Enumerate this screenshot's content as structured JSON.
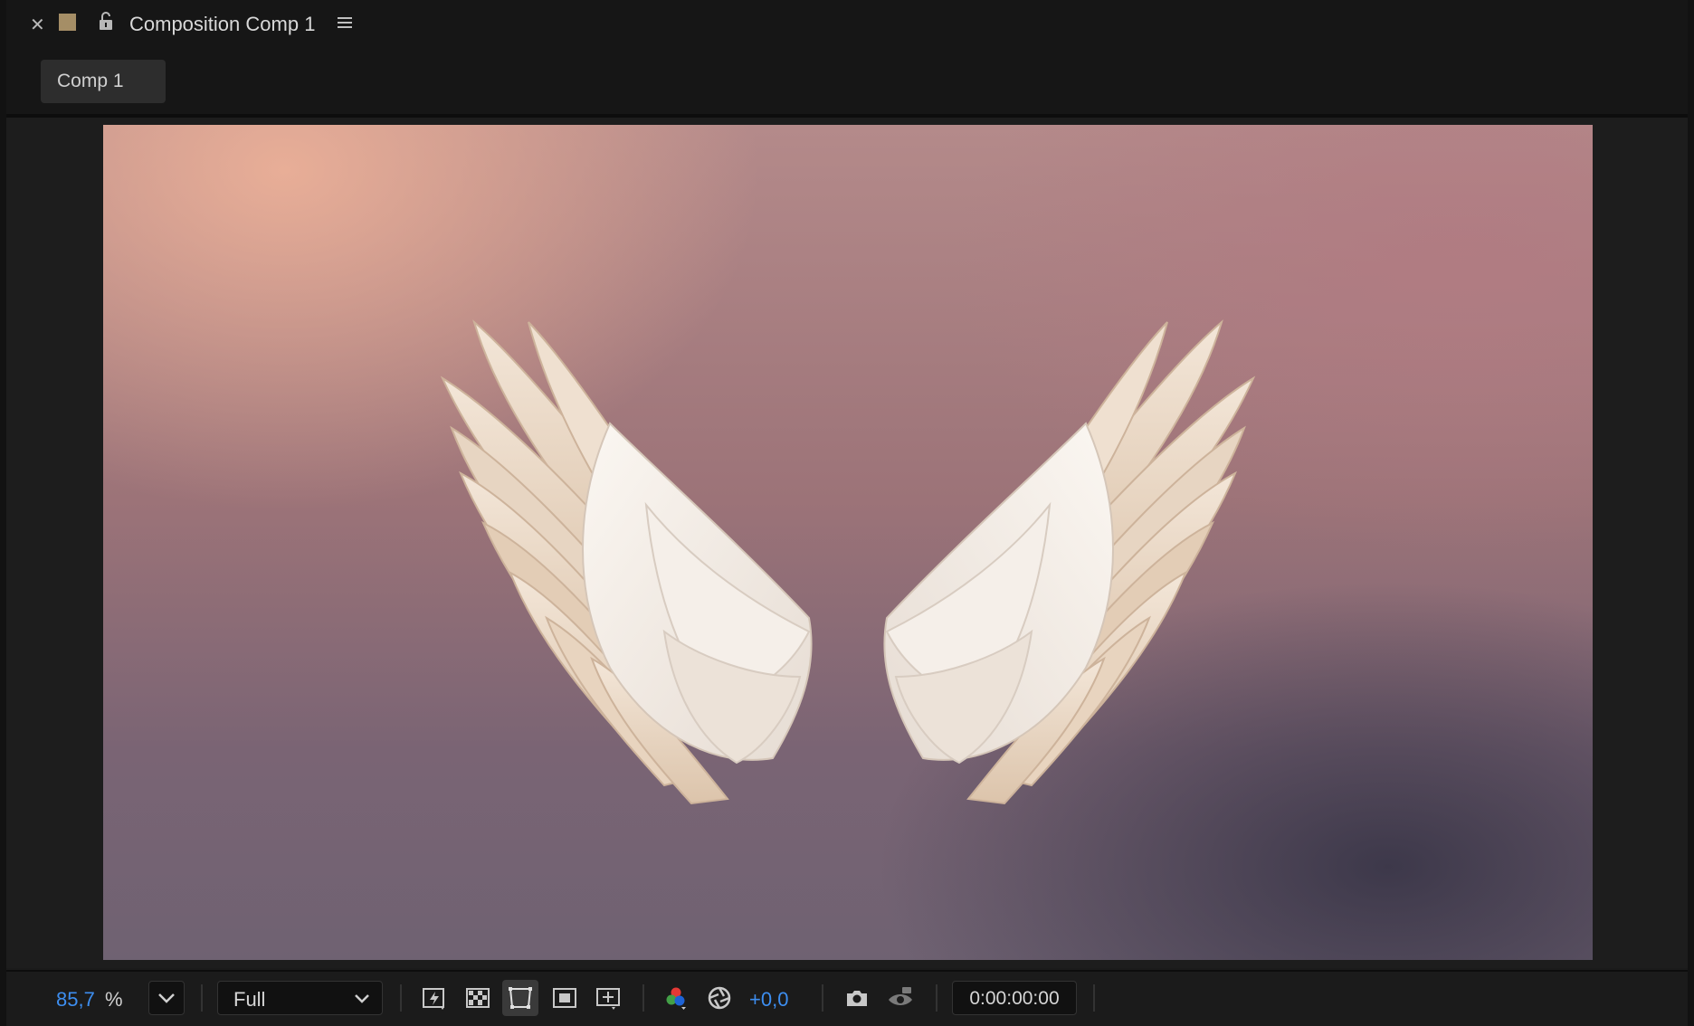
{
  "panel": {
    "title": "Composition Comp 1",
    "label_color": "#a58e66",
    "icons": [
      "close-icon",
      "label-swatch",
      "lock-icon",
      "panel-menu-icon"
    ]
  },
  "tabs": [
    {
      "label": "Comp 1",
      "active": true
    }
  ],
  "viewer": {
    "content": "angel-wings-artwork",
    "background_colors": [
      "#e9b09a",
      "#a07880",
      "#3d3a4a"
    ]
  },
  "toolbar": {
    "zoom_value": "85,7",
    "zoom_unit": "%",
    "resolution": "Full",
    "exposure": "+0,0",
    "timecode": "0:00:00:00",
    "accent": "#3d8ef0",
    "icons": [
      "fast-previews-icon",
      "transparency-grid-icon",
      "mask-path-visibility-icon",
      "region-of-interest-icon",
      "guides-icon",
      "channel-icon",
      "exposure-reset-icon",
      "snapshot-icon",
      "show-snapshot-icon"
    ]
  }
}
